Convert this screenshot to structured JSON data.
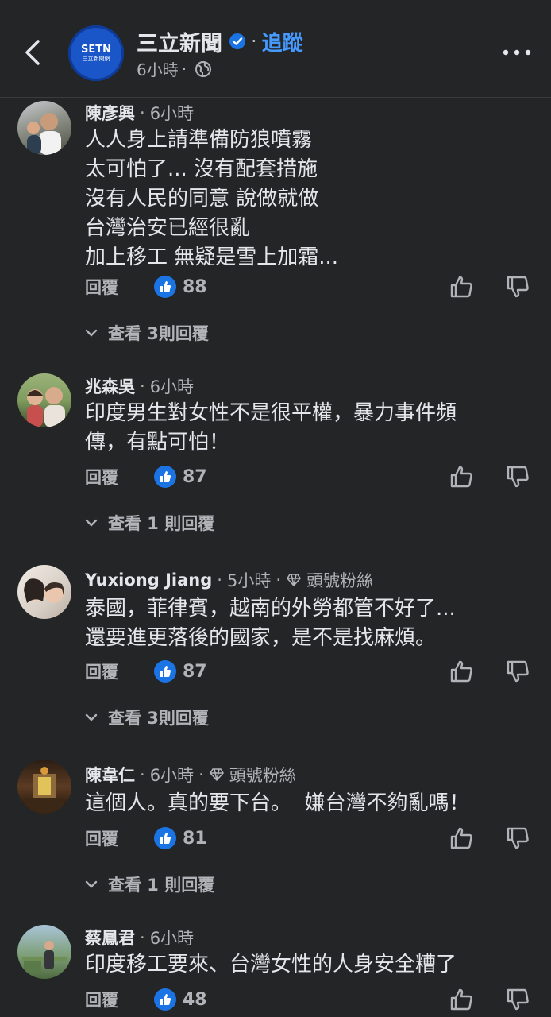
{
  "header": {
    "page_name": "三立新聞",
    "follow_label": "追蹤",
    "time": "6小時",
    "dot": "·",
    "logo_top": "SETN",
    "logo_bottom": "三立新聞網"
  },
  "actions": {
    "reply_label": "回覆"
  },
  "comments": [
    {
      "name": "陳彥興",
      "time": "6小時",
      "badge": "",
      "text": "人人身上請準備防狼噴霧\n太可怕了... 沒有配套措施\n沒有人民的同意 說做就做\n台灣治安已經很亂\n加上移工 無疑是雪上加霜...",
      "likes": "88",
      "replies": "查看 3則回覆"
    },
    {
      "name": "兆森吳",
      "time": "6小時",
      "badge": "",
      "text": "印度男生對女性不是很平權，暴力事件頻\n傳，有點可怕！",
      "likes": "87",
      "replies": "查看 1 則回覆"
    },
    {
      "name": "Yuxiong Jiang",
      "time": "5小時",
      "badge": "頭號粉絲",
      "text": "泰國，菲律賓，越南的外勞都管不好了...\n還要進更落後的國家，是不是找麻煩。",
      "likes": "87",
      "replies": "查看 3則回覆"
    },
    {
      "name": "陳韋仁",
      "time": "6小時",
      "badge": "頭號粉絲",
      "text": "這個人。真的要下台。  嫌台灣不夠亂嗎！",
      "likes": "81",
      "replies": "查看 1 則回覆"
    },
    {
      "name": "蔡鳳君",
      "time": "6小時",
      "badge": "",
      "text": "印度移工要來、台灣女性的人身安全糟了",
      "likes": "48",
      "replies": ""
    }
  ],
  "colors": {
    "background": "#242526",
    "accent": "#4599ff",
    "like": "#1b74e4"
  },
  "icons": [
    "back-arrow-icon",
    "verified-badge-icon",
    "globe-icon",
    "more-icon",
    "like-icon",
    "thumbs-up-icon",
    "thumbs-down-icon",
    "chevron-down-icon",
    "diamond-icon"
  ]
}
